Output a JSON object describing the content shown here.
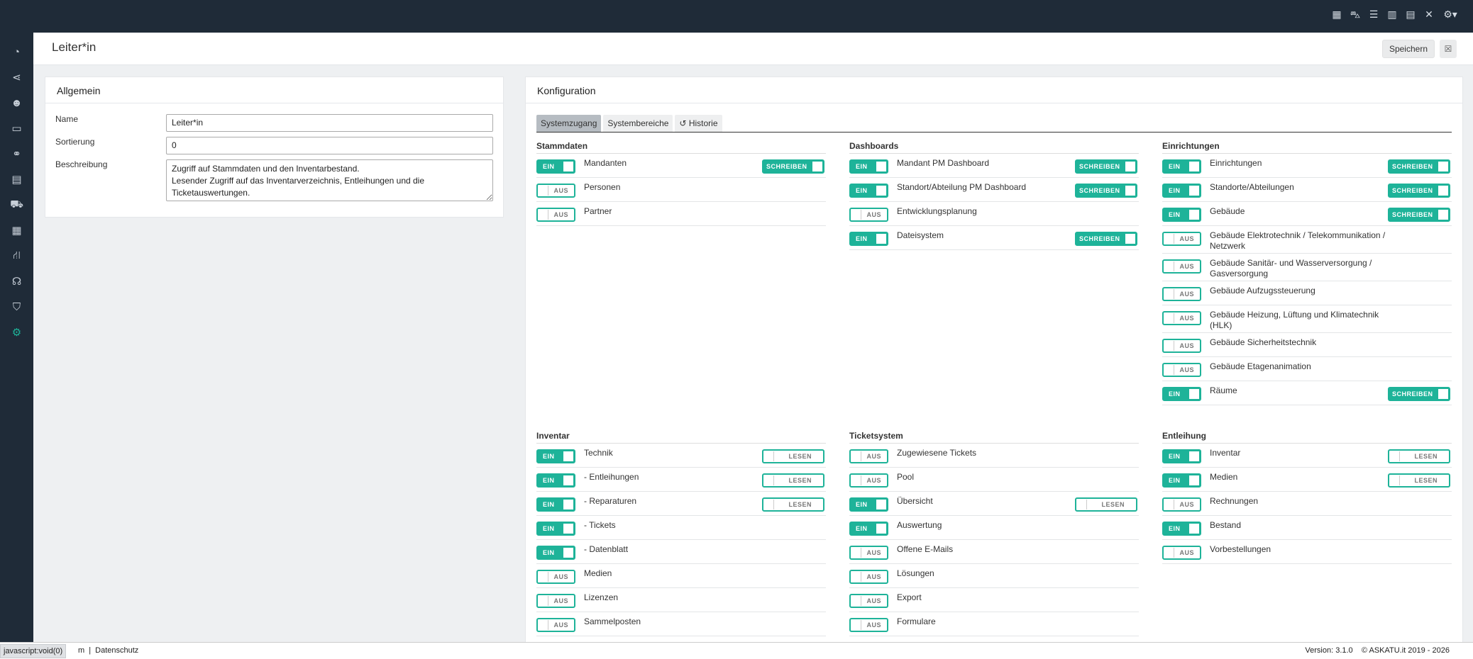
{
  "topbar": {
    "icons": [
      "calendar-icon",
      "car-icon",
      "list-icon",
      "clipboard-icon",
      "document-icon",
      "tools-icon",
      "settings-dropdown-icon"
    ]
  },
  "sidebar": {
    "items": [
      {
        "icon": "dashboard-icon",
        "glyph": "◔"
      },
      {
        "icon": "share-icon",
        "glyph": "⋖"
      },
      {
        "icon": "users-icon",
        "glyph": "☻"
      },
      {
        "icon": "monitor-icon",
        "glyph": "▭"
      },
      {
        "icon": "handshake-icon",
        "glyph": "⚭"
      },
      {
        "icon": "file-icon",
        "glyph": "▤"
      },
      {
        "icon": "cart-icon",
        "glyph": "⛟"
      },
      {
        "icon": "boxes-icon",
        "glyph": "▦"
      },
      {
        "icon": "sitemap-icon",
        "glyph": "⛙"
      },
      {
        "icon": "support-icon",
        "glyph": "☊"
      },
      {
        "icon": "shield-icon",
        "glyph": "⛉"
      },
      {
        "icon": "cogs-icon",
        "glyph": "⚙"
      }
    ]
  },
  "header": {
    "title": "Leiter*in",
    "save_label": "Speichern",
    "close_glyph": "☒"
  },
  "allgemein": {
    "title": "Allgemein",
    "name_label": "Name",
    "name_value": "Leiter*in",
    "sort_label": "Sortierung",
    "sort_value": "0",
    "desc_label": "Beschreibung",
    "desc_value": "Zugriff auf Stammdaten und den Inventarbestand.\nLesender Zugriff auf das Inventarverzeichnis, Entleihungen und die Ticketauswertungen."
  },
  "konfiguration": {
    "title": "Konfiguration",
    "tabs": [
      "Systemzugang",
      "Systembereiche",
      "↺ Historie"
    ],
    "sections": [
      {
        "title": "Stammdaten",
        "rows": [
          {
            "label": "Mandanten",
            "state": "EIN",
            "right": "SCHREIBEN",
            "right_on": true
          },
          {
            "label": "Personen",
            "state": "AUS"
          },
          {
            "label": "Partner",
            "state": "AUS"
          }
        ]
      },
      {
        "title": "Dashboards",
        "rows": [
          {
            "label": "Mandant PM Dashboard",
            "state": "EIN",
            "right": "SCHREIBEN",
            "right_on": true
          },
          {
            "label": "Standort/Abteilung PM Dashboard",
            "state": "EIN",
            "right": "SCHREIBEN",
            "right_on": true
          },
          {
            "label": "Entwicklungsplanung",
            "state": "AUS"
          },
          {
            "label": "Dateisystem",
            "state": "EIN",
            "right": "SCHREIBEN",
            "right_on": true
          }
        ]
      },
      {
        "title": "Einrichtungen",
        "rows": [
          {
            "label": "Einrichtungen",
            "state": "EIN",
            "right": "SCHREIBEN",
            "right_on": true
          },
          {
            "label": "Standorte/Abteilungen",
            "state": "EIN",
            "right": "SCHREIBEN",
            "right_on": true
          },
          {
            "label": "Gebäude",
            "state": "EIN",
            "right": "SCHREIBEN",
            "right_on": true
          },
          {
            "label": "Gebäude Elektrotechnik / Telekommunikation / Netzwerk",
            "state": "AUS",
            "tall": true
          },
          {
            "label": "Gebäude Sanitär- und Wasserversorgung / Gasversorgung",
            "state": "AUS",
            "tall": true
          },
          {
            "label": "Gebäude Aufzugssteuerung",
            "state": "AUS"
          },
          {
            "label": "Gebäude Heizung, Lüftung und Klimatechnik (HLK)",
            "state": "AUS",
            "tall": true
          },
          {
            "label": "Gebäude Sicherheitstechnik",
            "state": "AUS"
          },
          {
            "label": "Gebäude Etagenanimation",
            "state": "AUS"
          },
          {
            "label": "Räume",
            "state": "EIN",
            "right": "SCHREIBEN",
            "right_on": true
          }
        ]
      },
      {
        "title": "Inventar",
        "rows": [
          {
            "label": "Technik",
            "state": "EIN",
            "right": "LESEN",
            "right_on": false
          },
          {
            "label": "- Entleihungen",
            "state": "EIN",
            "right": "LESEN",
            "right_on": false
          },
          {
            "label": "- Reparaturen",
            "state": "EIN",
            "right": "LESEN",
            "right_on": false
          },
          {
            "label": "- Tickets",
            "state": "EIN"
          },
          {
            "label": "- Datenblatt",
            "state": "EIN"
          },
          {
            "label": "Medien",
            "state": "AUS"
          },
          {
            "label": "Lizenzen",
            "state": "AUS"
          },
          {
            "label": "Sammelposten",
            "state": "AUS"
          }
        ]
      },
      {
        "title": "Ticketsystem",
        "rows": [
          {
            "label": "Zugewiesene Tickets",
            "state": "AUS"
          },
          {
            "label": "Pool",
            "state": "AUS"
          },
          {
            "label": "Übersicht",
            "state": "EIN",
            "right": "LESEN",
            "right_on": false
          },
          {
            "label": "Auswertung",
            "state": "EIN"
          },
          {
            "label": "Offene E-Mails",
            "state": "AUS"
          },
          {
            "label": "Lösungen",
            "state": "AUS"
          },
          {
            "label": "Export",
            "state": "AUS"
          },
          {
            "label": "Formulare",
            "state": "AUS"
          }
        ]
      },
      {
        "title": "Entleihung",
        "rows": [
          {
            "label": "Inventar",
            "state": "EIN",
            "right": "LESEN",
            "right_on": false
          },
          {
            "label": "Medien",
            "state": "EIN",
            "right": "LESEN",
            "right_on": false
          },
          {
            "label": "Rechnungen",
            "state": "AUS"
          },
          {
            "label": "Bestand",
            "state": "EIN"
          },
          {
            "label": "Vorbestellungen",
            "state": "AUS"
          }
        ]
      }
    ]
  },
  "footer": {
    "status_text": "javascript:void(0)",
    "link_partial": "m",
    "separator": "|",
    "privacy": "Datenschutz",
    "version": "Version: 3.1.0",
    "copyright": "© ASKATU.it 2019 - 2026"
  },
  "colors": {
    "topbar": "#1f2b38",
    "accent": "#1eb399",
    "background": "#eef0f2"
  }
}
